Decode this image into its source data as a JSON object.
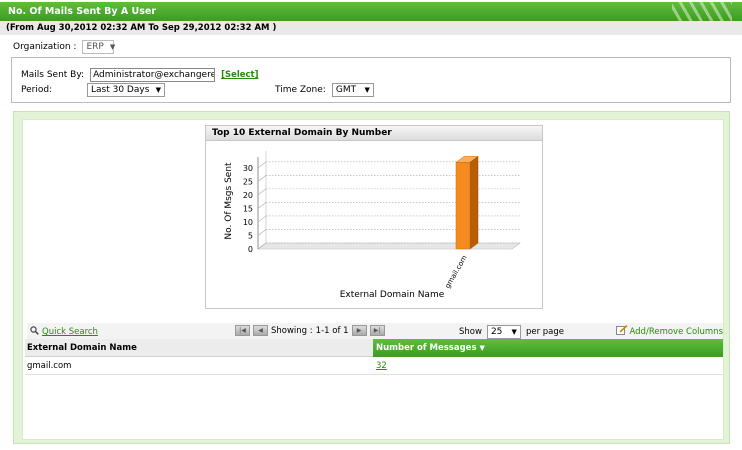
{
  "header": {
    "title": "No. Of Mails Sent By A User",
    "date_range": "(From Aug 30,2012 02:32 AM To Sep 29,2012 02:32 AM )"
  },
  "filters": {
    "organization_label": "Organization :",
    "organization_value": "ERP",
    "mails_sent_by_label": "Mails Sent By:",
    "mails_sent_by_value": "Administrator@exchangerepor",
    "select_link": "[Select]",
    "period_label": "Period:",
    "period_value": "Last 30 Days",
    "timezone_label": "Time Zone:",
    "timezone_value": "GMT"
  },
  "chart_data": {
    "type": "bar",
    "title": "Top 10 External Domain By Number",
    "categories": [
      "gmail.com"
    ],
    "values": [
      32
    ],
    "xlabel": "External Domain Name",
    "ylabel": "No. Of Msgs Sent",
    "ylim": [
      0,
      34
    ],
    "yticks": [
      0,
      5,
      10,
      15,
      20,
      25,
      30
    ],
    "bar_color": "#f58b1f",
    "grid": true
  },
  "grid": {
    "quick_search": "Quick Search",
    "showing_label": "Showing :",
    "showing_value": "1-1 of 1",
    "show_label": "Show",
    "page_size": "25",
    "per_page": "per page",
    "add_remove": "Add/Remove Columns",
    "columns": [
      "External Domain Name",
      "Number of Messages"
    ],
    "rows": [
      {
        "domain": "gmail.com",
        "count": "32"
      }
    ]
  },
  "colors": {
    "brand_green": "#3f9a24",
    "link_green": "#2a8a0a",
    "bar_orange": "#f58b1f"
  }
}
